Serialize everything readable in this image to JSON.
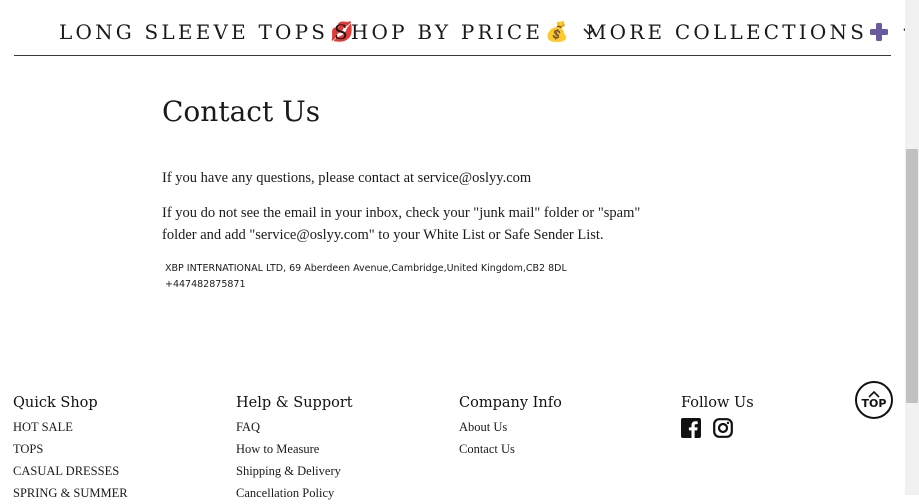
{
  "nav": {
    "items": [
      {
        "label": "LONG SLEEVE TOPS",
        "emoji": "💋",
        "has_dropdown": false
      },
      {
        "label": "SHOP BY PRICE",
        "emoji": "💰",
        "has_dropdown": true
      },
      {
        "label": "MORE COLLECTIONS",
        "emoji": "➕",
        "has_dropdown": true
      }
    ]
  },
  "contact": {
    "title": "Contact Us",
    "line1": "If you have any questions, please contact at service@oslyy.com",
    "line2": "If you do not see the email in your inbox, check your \"junk mail\" folder or \"spam\" folder and add \"service@oslyy.com\" to your White List or Safe Sender List.",
    "address": "XBP INTERNATIONAL LTD, 69 Aberdeen Avenue,Cambridge,United Kingdom,CB2 8DL",
    "phone": "+447482875871"
  },
  "footer": {
    "quick_shop": {
      "title": "Quick Shop",
      "links": [
        "HOT SALE",
        "TOPS",
        "CASUAL DRESSES",
        "SPRING & SUMMER"
      ]
    },
    "help": {
      "title": "Help & Support",
      "links": [
        "FAQ",
        "How to Measure",
        "Shipping & Delivery",
        "Cancellation Policy"
      ]
    },
    "company": {
      "title": "Company Info",
      "links": [
        "About Us",
        "Contact Us"
      ]
    },
    "follow": {
      "title": "Follow Us",
      "icons": [
        "facebook-icon",
        "instagram-icon"
      ]
    }
  },
  "back_to_top": {
    "label": "TOP"
  },
  "colors": {
    "text": "#1a1a1a",
    "rule": "#3a3a3a",
    "plus_icon": "#6a5aa0",
    "scroll_thumb": "#c1c1c1"
  }
}
